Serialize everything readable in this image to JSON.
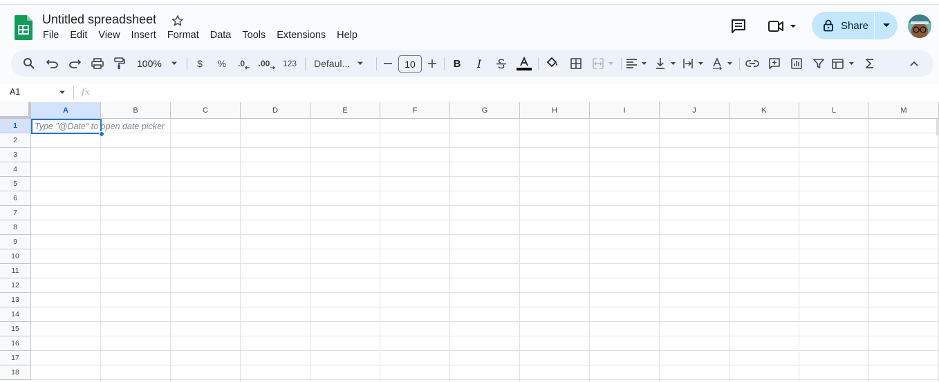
{
  "doc": {
    "title": "Untitled spreadsheet"
  },
  "menu": [
    "File",
    "Edit",
    "View",
    "Insert",
    "Format",
    "Data",
    "Tools",
    "Extensions",
    "Help"
  ],
  "share": {
    "label": "Share"
  },
  "toolbar": {
    "zoom": "100%",
    "currency": "$",
    "percent": "%",
    "decrease_decimal": ".0",
    "increase_decimal": ".00",
    "number_format": "123",
    "font": "Defaul...",
    "font_size": "10",
    "bold": "B",
    "italic": "I"
  },
  "formula_bar": {
    "name_box": "A1",
    "fx": "fx"
  },
  "grid": {
    "columns": [
      "A",
      "B",
      "C",
      "D",
      "E",
      "F",
      "G",
      "H",
      "I",
      "J",
      "K",
      "L",
      "M"
    ],
    "rows": [
      "1",
      "2",
      "3",
      "4",
      "5",
      "6",
      "7",
      "8",
      "9",
      "10",
      "11",
      "12",
      "13",
      "14",
      "15",
      "16",
      "17",
      "18"
    ],
    "selected_cell": "A1",
    "cell_hint": "Type \"@Date\" to open date picker"
  },
  "colors": {
    "accent": "#1a73e8",
    "share_bg": "#c2e7ff",
    "toolbar_bg": "#edf2fa",
    "sheets_green": "#0f9d58"
  }
}
